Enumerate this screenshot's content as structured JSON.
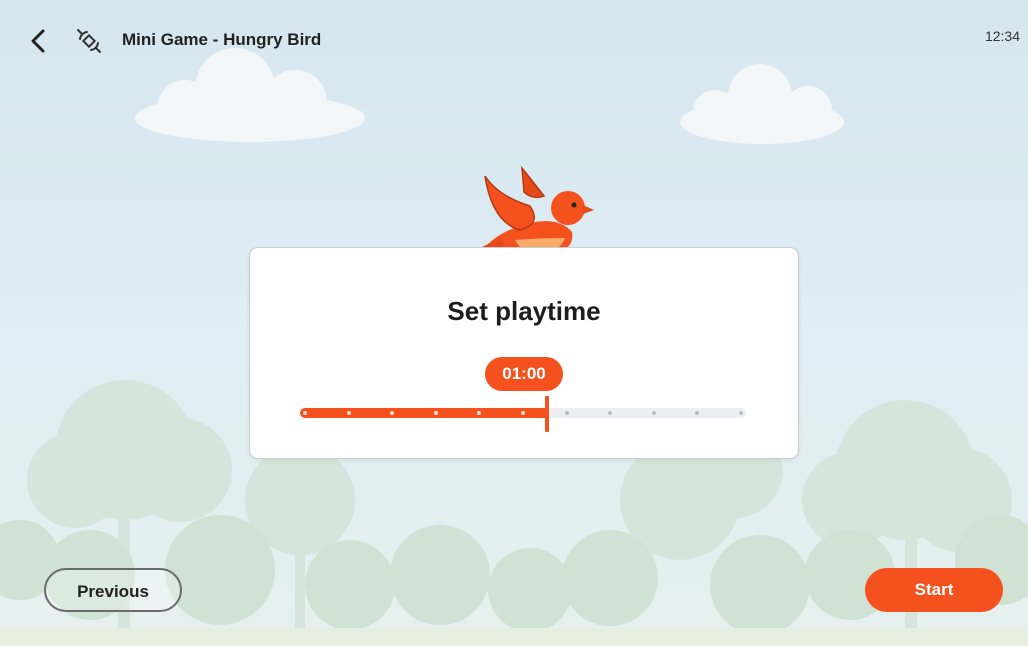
{
  "header": {
    "back_icon": "chevron-left-icon",
    "app_icon": "satellite-icon",
    "title": "Mini Game - Hungry Bird",
    "clock": "12:34"
  },
  "card": {
    "title": "Set playtime",
    "time_value": "01:00",
    "slider_fraction": 0.5,
    "slider_steps": 10
  },
  "buttons": {
    "previous_label": "Previous",
    "start_label": "Start"
  },
  "colors": {
    "accent": "#f4511e",
    "sky": "#d6e6ef",
    "track": "#eceef3"
  }
}
